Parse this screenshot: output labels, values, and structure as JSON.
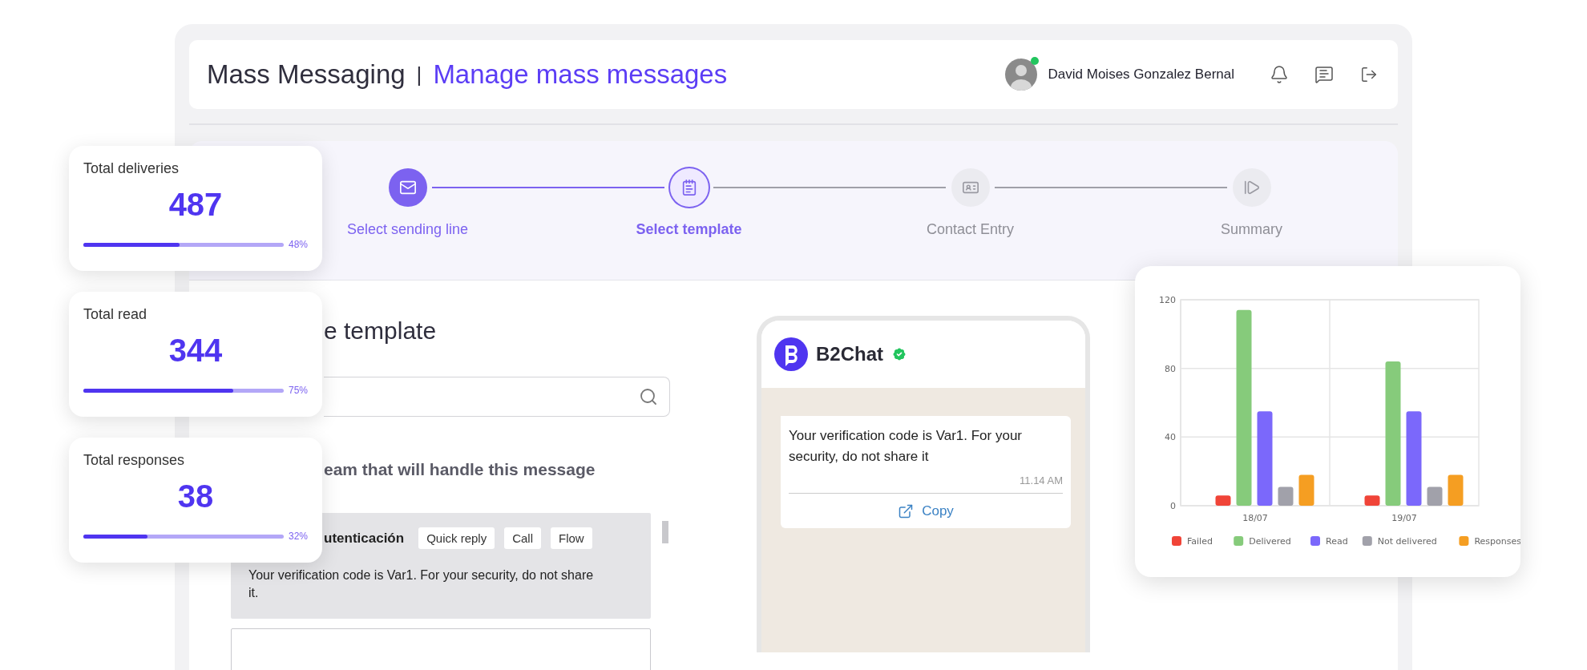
{
  "header": {
    "title": "Mass Messaging",
    "separator": "|",
    "subtitle": "Manage mass messages",
    "user": {
      "name": "David Moises Gonzalez Bernal",
      "online": true
    }
  },
  "steps": [
    {
      "label": "Select sending line",
      "completed": true,
      "selected": false
    },
    {
      "label": "Select template",
      "completed": false,
      "selected": true
    },
    {
      "label": "Contact Entry",
      "completed": false,
      "selected": false
    },
    {
      "label": "Summary",
      "completed": false,
      "selected": false
    }
  ],
  "template_section": {
    "heading": "e template",
    "team_label": "eam that will handle this message",
    "templates": [
      {
        "name": "utenticación",
        "tags": [
          "Quick reply",
          "Call",
          "Flow"
        ],
        "body": "Your verification code is Var1. For your security, do not share it.",
        "selected": true
      },
      {
        "selected": false
      }
    ]
  },
  "preview": {
    "sender": "B2Chat",
    "verified": true,
    "message": "Your verification code is Var1. For your security, do not share it",
    "time": "11.14 AM",
    "action": "Copy"
  },
  "stats": [
    {
      "label": "Total deliveries",
      "value": "487",
      "level": 0.48,
      "percent": "48%"
    },
    {
      "label": "Total read",
      "value": "344",
      "level": 0.75,
      "percent": "75%"
    },
    {
      "label": "Total responses",
      "value": "38",
      "level": 0.32,
      "percent": "32%"
    }
  ],
  "chart_data": {
    "type": "bar",
    "legend": "bottom",
    "categories": [
      "18/07",
      "19/07"
    ],
    "yticks": [
      0,
      40,
      80,
      120
    ],
    "ylim": [
      0,
      120
    ],
    "series": [
      {
        "name": "Failed",
        "color": "#f04438",
        "values": [
          6,
          6
        ]
      },
      {
        "name": "Delivered",
        "color": "#86cb7b",
        "values": [
          114,
          84
        ]
      },
      {
        "name": "Read",
        "color": "#7b68fb",
        "values": [
          55,
          55
        ]
      },
      {
        "name": "Not delivered",
        "color": "#a1a1aa",
        "values": [
          11,
          11
        ]
      },
      {
        "name": "Responses",
        "color": "#f59e22",
        "values": [
          18,
          18
        ]
      }
    ]
  }
}
